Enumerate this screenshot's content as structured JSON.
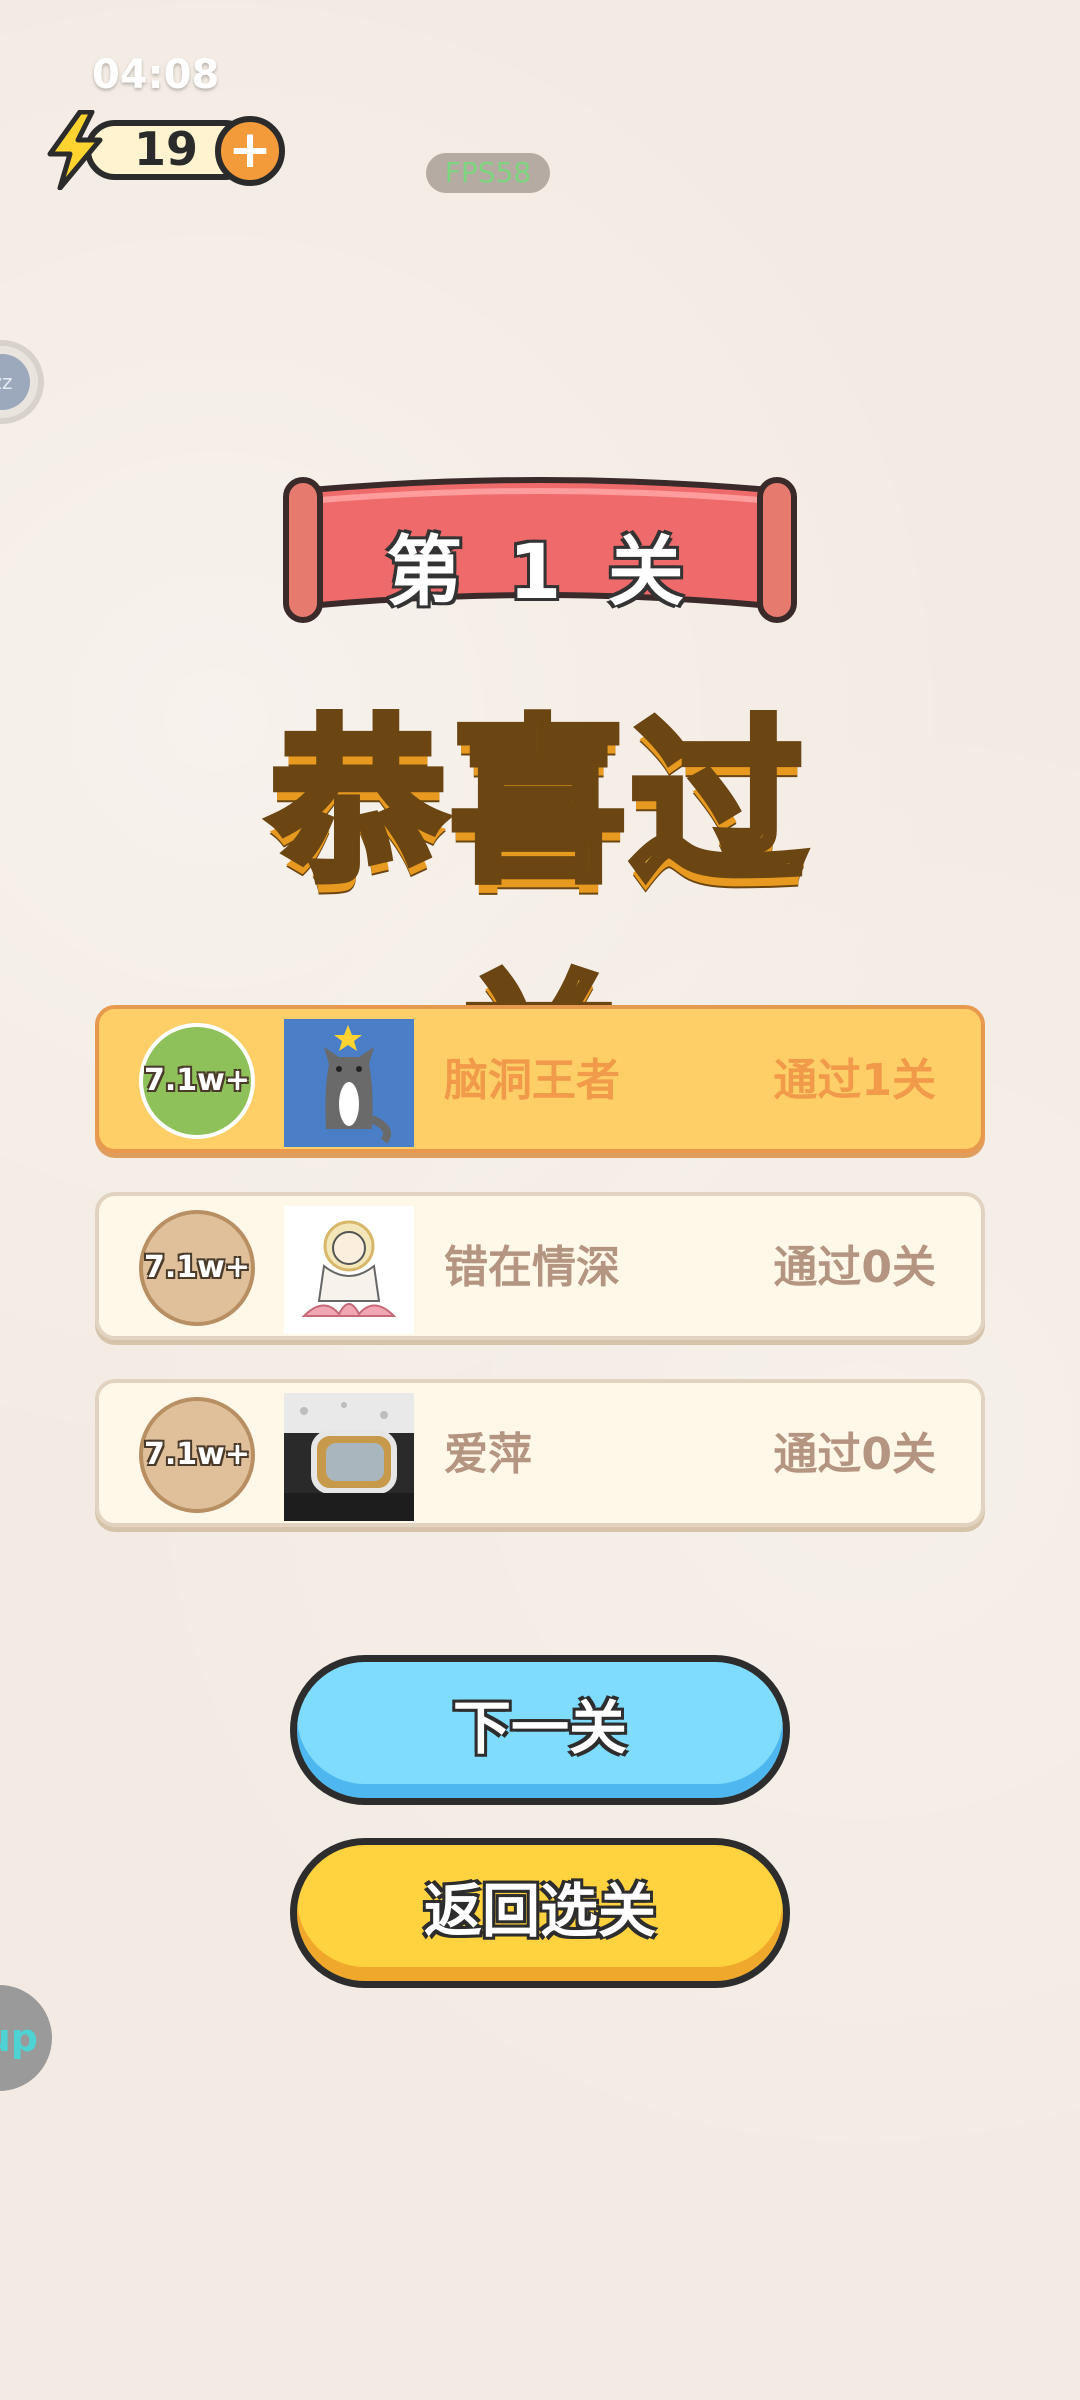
{
  "status": {
    "time": "04:08",
    "fps": "FPS58"
  },
  "energy": {
    "value": "19",
    "plus_label": "+"
  },
  "side_widgets": {
    "zz_label": "zz",
    "up_label": "up"
  },
  "level_banner": {
    "text": "第 1 关"
  },
  "title": "恭喜过关",
  "ranking": [
    {
      "badge": "7.1w+",
      "name": "脑洞王者",
      "progress": "通过1关",
      "highlighted": true
    },
    {
      "badge": "7.1w+",
      "name": "错在情深",
      "progress": "通过0关",
      "highlighted": false
    },
    {
      "badge": "7.1w+",
      "name": "爱萍",
      "progress": "通过0关",
      "highlighted": false
    }
  ],
  "buttons": {
    "next": "下一关",
    "back": "返回选关"
  },
  "colors": {
    "background": "#f3ebe3",
    "highlight_card": "#ffcf67",
    "card": "#fff8e8",
    "banner_red": "#ef6b6b",
    "next_button": "#7fdcff",
    "back_button": "#ffd23f"
  }
}
